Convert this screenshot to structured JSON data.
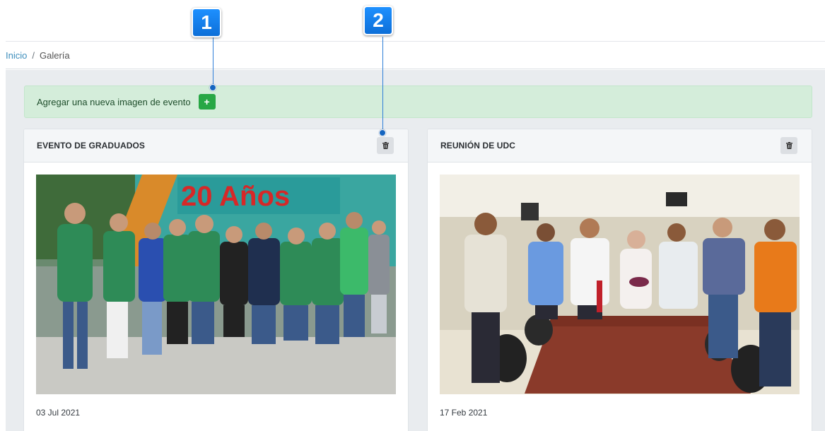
{
  "breadcrumb": {
    "home": "Inicio",
    "separator": "/",
    "current": "Galería"
  },
  "alert": {
    "text": "Agregar una nueva imagen de evento",
    "add_icon": "plus-icon",
    "color": "#d4edda"
  },
  "callouts": [
    {
      "label": "1"
    },
    {
      "label": "2"
    }
  ],
  "events": [
    {
      "title": "EVENTO DE GRADUADOS",
      "date": "03 Jul 2021",
      "banner_text": "20 Años",
      "delete_icon": "trash-icon"
    },
    {
      "title": "REUNIÓN DE UDC",
      "date": "17 Feb 2021",
      "delete_icon": "trash-icon"
    }
  ],
  "colors": {
    "link": "#3c8dbc",
    "success": "#28a745",
    "callout": "#1e90ff"
  }
}
